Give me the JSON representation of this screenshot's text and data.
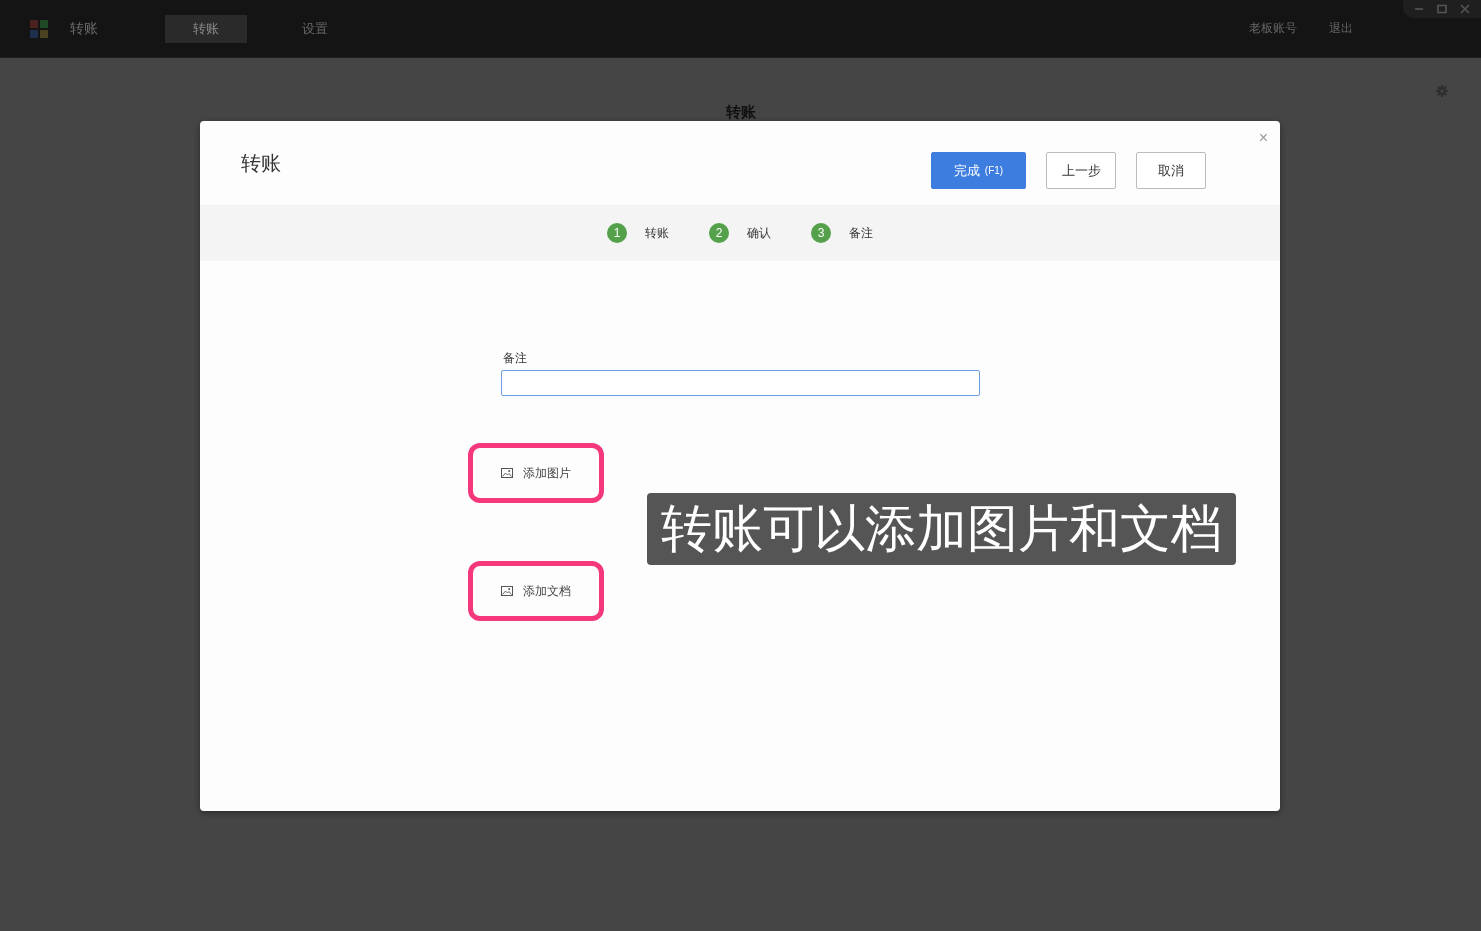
{
  "app_bar": {
    "title": "转账",
    "tabs": [
      {
        "label": "转账",
        "selected": true
      },
      {
        "label": "设置",
        "selected": false
      }
    ],
    "account": "老板账号",
    "logout": "退出"
  },
  "page": {
    "title": "转账"
  },
  "dialog": {
    "title": "转账",
    "buttons": [
      {
        "label": "完成",
        "shortcut": "(F1)",
        "kind": "primary"
      },
      {
        "label": "上一步",
        "kind": "secondary"
      },
      {
        "label": "取消",
        "kind": "secondary"
      }
    ],
    "close": "×",
    "steps": [
      {
        "number": "1",
        "label": "转账",
        "done": true
      },
      {
        "number": "2",
        "label": "确认",
        "done": true
      },
      {
        "number": "3",
        "label": "备注",
        "done": true
      }
    ],
    "remark": {
      "label": "备注",
      "focused": true
    },
    "attachments": [
      {
        "label": "添加图片",
        "highlighted": true
      },
      {
        "label": "添加文档",
        "highlighted": true
      }
    ]
  },
  "caption": {
    "text": "转账可以添加图片和文档"
  }
}
